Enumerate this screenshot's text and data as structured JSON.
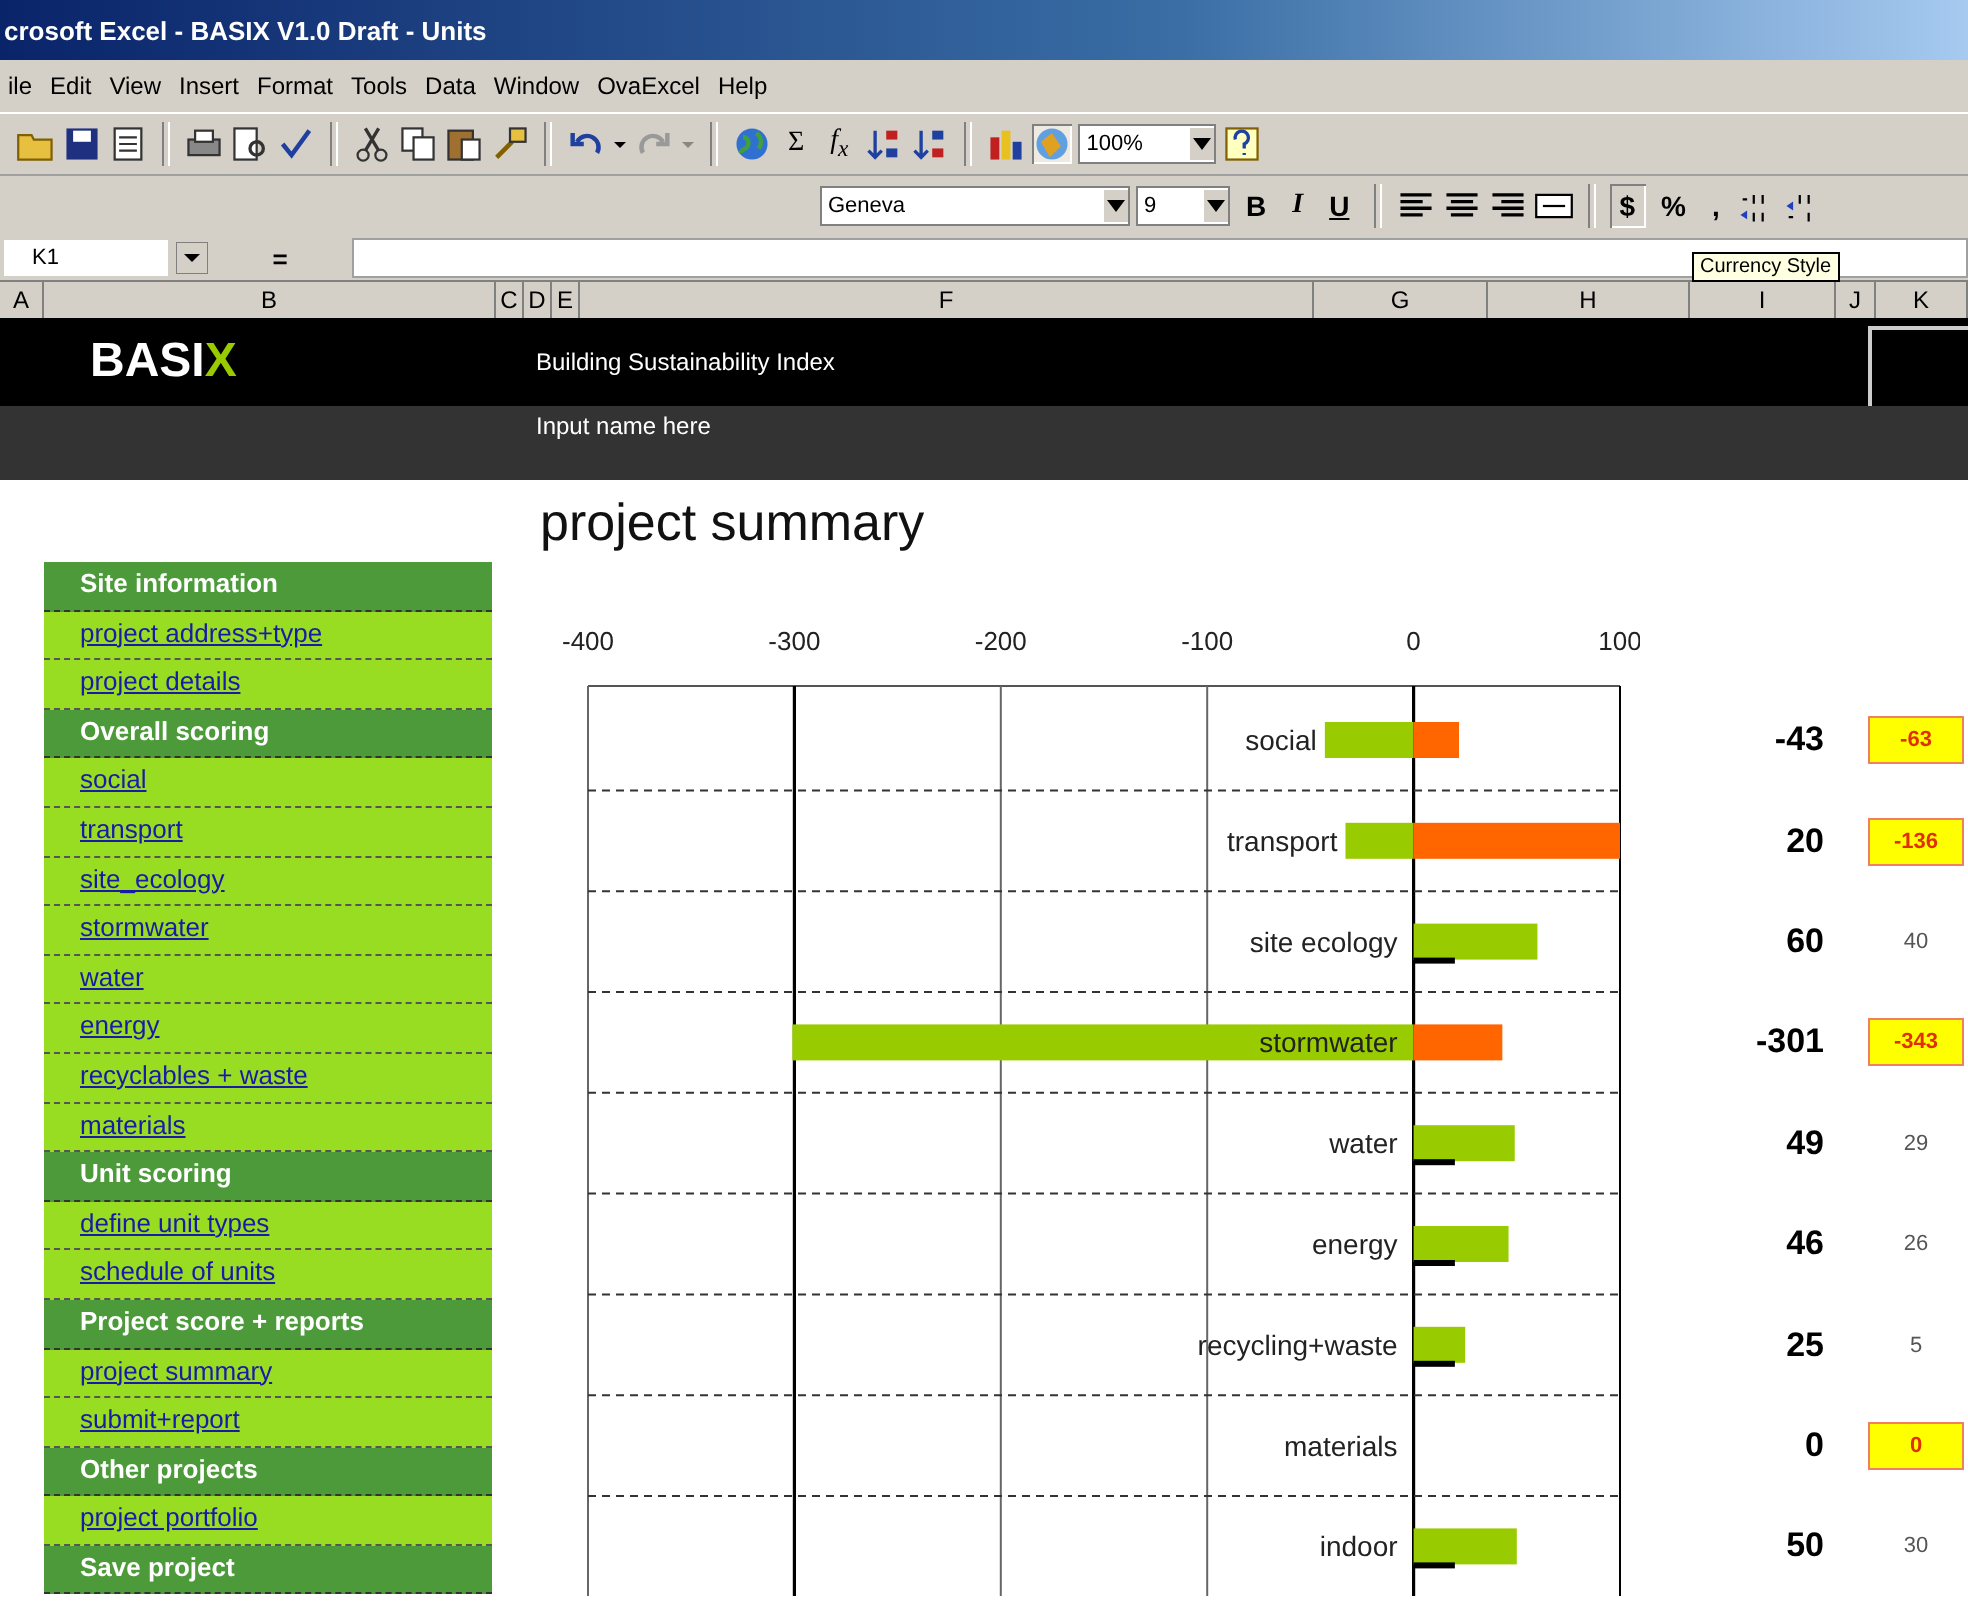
{
  "window": {
    "title": "crosoft Excel - BASIX V1.0 Draft - Units"
  },
  "menu": [
    "ile",
    "Edit",
    "View",
    "Insert",
    "Format",
    "Tools",
    "Data",
    "Window",
    "OvaExcel",
    "Help"
  ],
  "standard_toolbar": {
    "sum": "Σ",
    "function": "f$_{x}$",
    "zoom": "100%"
  },
  "formatting_toolbar": {
    "font": "Geneva",
    "size": "9",
    "style_buttons": [
      "B",
      "I",
      "U"
    ],
    "number_buttons": [
      "$",
      "%",
      ","
    ]
  },
  "formula_bar": {
    "name_box": "K1",
    "equals": "="
  },
  "tooltip": "Currency Style",
  "columns": [
    "A",
    "B",
    "C",
    "D",
    "E",
    "F",
    "G",
    "H",
    "I",
    "J",
    "K"
  ],
  "header": {
    "logo": "BASI",
    "logo_accent": "X",
    "subtitle": "Building Sustainability Index",
    "name_field": "Input name here"
  },
  "sidebar": [
    {
      "kind": "header",
      "label": "Site information"
    },
    {
      "kind": "link",
      "label": "project address+type"
    },
    {
      "kind": "link",
      "label": "project details"
    },
    {
      "kind": "header",
      "label": "Overall scoring"
    },
    {
      "kind": "link",
      "label": "social"
    },
    {
      "kind": "link",
      "label": "transport"
    },
    {
      "kind": "link",
      "label": "site_ecology"
    },
    {
      "kind": "link",
      "label": "stormwater"
    },
    {
      "kind": "link",
      "label": "water"
    },
    {
      "kind": "link",
      "label": "energy"
    },
    {
      "kind": "link",
      "label": "recyclables + waste"
    },
    {
      "kind": "link",
      "label": "materials"
    },
    {
      "kind": "header",
      "label": "Unit scoring"
    },
    {
      "kind": "link",
      "label": "define unit types"
    },
    {
      "kind": "link",
      "label": "schedule of units"
    },
    {
      "kind": "header",
      "label": "Project score + reports"
    },
    {
      "kind": "link",
      "label": "project summary"
    },
    {
      "kind": "link",
      "label": "submit+report"
    },
    {
      "kind": "header",
      "label": "Other projects"
    },
    {
      "kind": "link",
      "label": "project portfolio"
    },
    {
      "kind": "header",
      "label": "Save project"
    }
  ],
  "page_title": "project summary",
  "chart_data": {
    "type": "bar",
    "orientation": "horizontal",
    "categories": [
      "social",
      "transport",
      "site ecology",
      "stormwater",
      "water",
      "energy",
      "recycling+waste",
      "materials",
      "indoor"
    ],
    "series": [
      {
        "color": "#99cc00",
        "values": [
          -43,
          -33,
          60,
          -301,
          49,
          46,
          25,
          0,
          50
        ]
      },
      {
        "color": "#ff6600",
        "values": [
          22,
          100,
          null,
          43,
          null,
          null,
          null,
          null,
          null
        ]
      },
      {
        "color": "#000000",
        "values": [
          null,
          null,
          20,
          null,
          20,
          20,
          20,
          null,
          20
        ]
      }
    ],
    "grid": true,
    "xlim": [
      -400,
      100
    ],
    "xticks": [
      -400,
      -300,
      -200,
      -100,
      0,
      100
    ]
  },
  "scores": [
    {
      "score": "-43",
      "target": "-63",
      "flagged": true
    },
    {
      "score": "20",
      "target": "-136",
      "flagged": true
    },
    {
      "score": "60",
      "target": "40",
      "flagged": false
    },
    {
      "score": "-301",
      "target": "-343",
      "flagged": true
    },
    {
      "score": "49",
      "target": "29",
      "flagged": false
    },
    {
      "score": "46",
      "target": "26",
      "flagged": false
    },
    {
      "score": "25",
      "target": "5",
      "flagged": false
    },
    {
      "score": "0",
      "target": "0",
      "flagged": true
    },
    {
      "score": "50",
      "target": "30",
      "flagged": false
    }
  ]
}
